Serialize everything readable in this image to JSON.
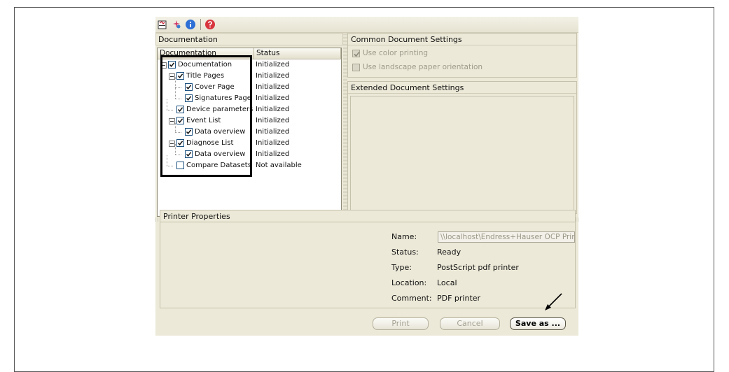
{
  "documentation_panel": {
    "title": "Documentation",
    "columns": [
      "Documentation",
      "Status"
    ],
    "tree": [
      {
        "label": "Documentation",
        "status": "Initialized",
        "checked": true,
        "level": 0,
        "expander": true
      },
      {
        "label": "Title Pages",
        "status": "Initialized",
        "checked": true,
        "level": 1,
        "expander": true
      },
      {
        "label": "Cover Page",
        "status": "Initialized",
        "checked": true,
        "level": 2,
        "expander": false
      },
      {
        "label": "Signatures Page",
        "status": "Initialized",
        "checked": true,
        "level": 2,
        "expander": false
      },
      {
        "label": "Device parameters",
        "status": "Initialized",
        "checked": true,
        "level": 1,
        "expander": false
      },
      {
        "label": "Event List",
        "status": "Initialized",
        "checked": true,
        "level": 1,
        "expander": true
      },
      {
        "label": "Data overview",
        "status": "Initialized",
        "checked": true,
        "level": 2,
        "expander": false
      },
      {
        "label": "Diagnose List",
        "status": "Initialized",
        "checked": true,
        "level": 1,
        "expander": true
      },
      {
        "label": "Data overview",
        "status": "Initialized",
        "checked": true,
        "level": 2,
        "expander": false
      },
      {
        "label": "Compare Datasets",
        "status": "Not available",
        "checked": false,
        "level": 1,
        "expander": false
      }
    ]
  },
  "common_settings": {
    "title": "Common Document Settings",
    "use_color_printing": "Use color printing",
    "use_landscape": "Use landscape paper orientation"
  },
  "extended_settings": {
    "title": "Extended Document Settings"
  },
  "printer": {
    "title": "Printer Properties",
    "name_label": "Name:",
    "name_value": "\\\\localhost\\Endress+Hauser OCP Printer",
    "status_label": "Status:",
    "status_value": "Ready",
    "type_label": "Type:",
    "type_value": "PostScript pdf printer",
    "location_label": "Location:",
    "location_value": "Local",
    "comment_label": "Comment:",
    "comment_value": "PDF printer"
  },
  "buttons": {
    "print": "Print",
    "cancel": "Cancel",
    "save_as": "Save as ..."
  },
  "toolbar": {
    "icons": [
      "document-icon",
      "settings-icon",
      "info-icon",
      "help-icon"
    ]
  },
  "colors": {
    "window_bg": "#ece9d8",
    "checkbox_border": "#1c5180",
    "info_blue": "#2e6fd6",
    "help_red": "#d8343d"
  }
}
